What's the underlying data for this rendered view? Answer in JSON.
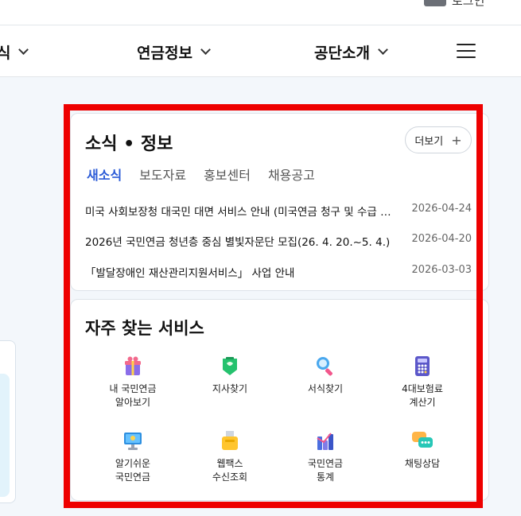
{
  "header": {
    "login_label": "로그인"
  },
  "nav": {
    "items": [
      {
        "label": "식"
      },
      {
        "label": "연금정보"
      },
      {
        "label": "공단소개"
      }
    ]
  },
  "news": {
    "title": "소식 • 정보",
    "more_label": "더보기",
    "tabs": [
      {
        "label": "새소식"
      },
      {
        "label": "보도자료"
      },
      {
        "label": "홍보센터"
      },
      {
        "label": "채용공고"
      }
    ],
    "rows": [
      {
        "text": "미국 사회보장청 대국민 대면 서비스 안내 (미국연금 청구 및 수급 관련)",
        "date": "2026-04-24"
      },
      {
        "text": "2026년 국민연금 청년층 중심 별빛자문단 모집(26. 4. 20.~5. 4.)",
        "date": "2026-04-20"
      },
      {
        "text": "「발달장애인 재산관리지원서비스」 사업 안내",
        "date": "2026-03-03"
      }
    ]
  },
  "services": {
    "title": "자주 찾는 서비스",
    "items": [
      {
        "label": "내 국민연금\n알아보기",
        "icon": "gift-icon"
      },
      {
        "label": "지사찾기",
        "icon": "map-pin-icon"
      },
      {
        "label": "서식찾기",
        "icon": "magnifier-icon"
      },
      {
        "label": "4대보험료\n계산기",
        "icon": "calculator-icon"
      },
      {
        "label": "알기쉬운\n국민연금",
        "icon": "monitor-icon"
      },
      {
        "label": "웹팩스\n수신조회",
        "icon": "fax-icon"
      },
      {
        "label": "국민연금\n통계",
        "icon": "bar-chart-icon"
      },
      {
        "label": "채팅상담",
        "icon": "chat-bubbles-icon"
      }
    ]
  },
  "colors": {
    "accent": "#2b5bd7",
    "highlight": "#ee0000"
  }
}
